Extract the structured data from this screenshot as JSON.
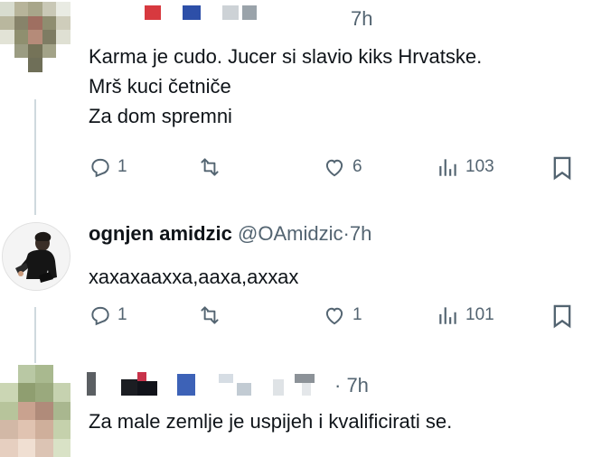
{
  "tweets": [
    {
      "time": "7h",
      "text_lines": [
        "Karma je cudo. Jucer si slavio kiks Hrvatske.",
        "Mrš kuci četniče",
        "Za dom spremni"
      ],
      "replies": "1",
      "reposts": "",
      "likes": "6",
      "views": "103"
    },
    {
      "display_name": "ognjen amidzic",
      "handle": "@OAmidzic",
      "separator": "·",
      "time": "7h",
      "text": "хахахаахха,аахa,аххах",
      "replies": "1",
      "reposts": "",
      "likes": "1",
      "views": "101"
    },
    {
      "time": "· 7h",
      "text": "Za male zemlje je uspijeh i kvalificirati se."
    }
  ],
  "colors": {
    "text": "#0f1419",
    "secondary": "#536471",
    "thread_line": "#cfd9de"
  },
  "icons": [
    "reply-icon",
    "repost-icon",
    "like-icon",
    "views-icon",
    "bookmark-icon"
  ]
}
